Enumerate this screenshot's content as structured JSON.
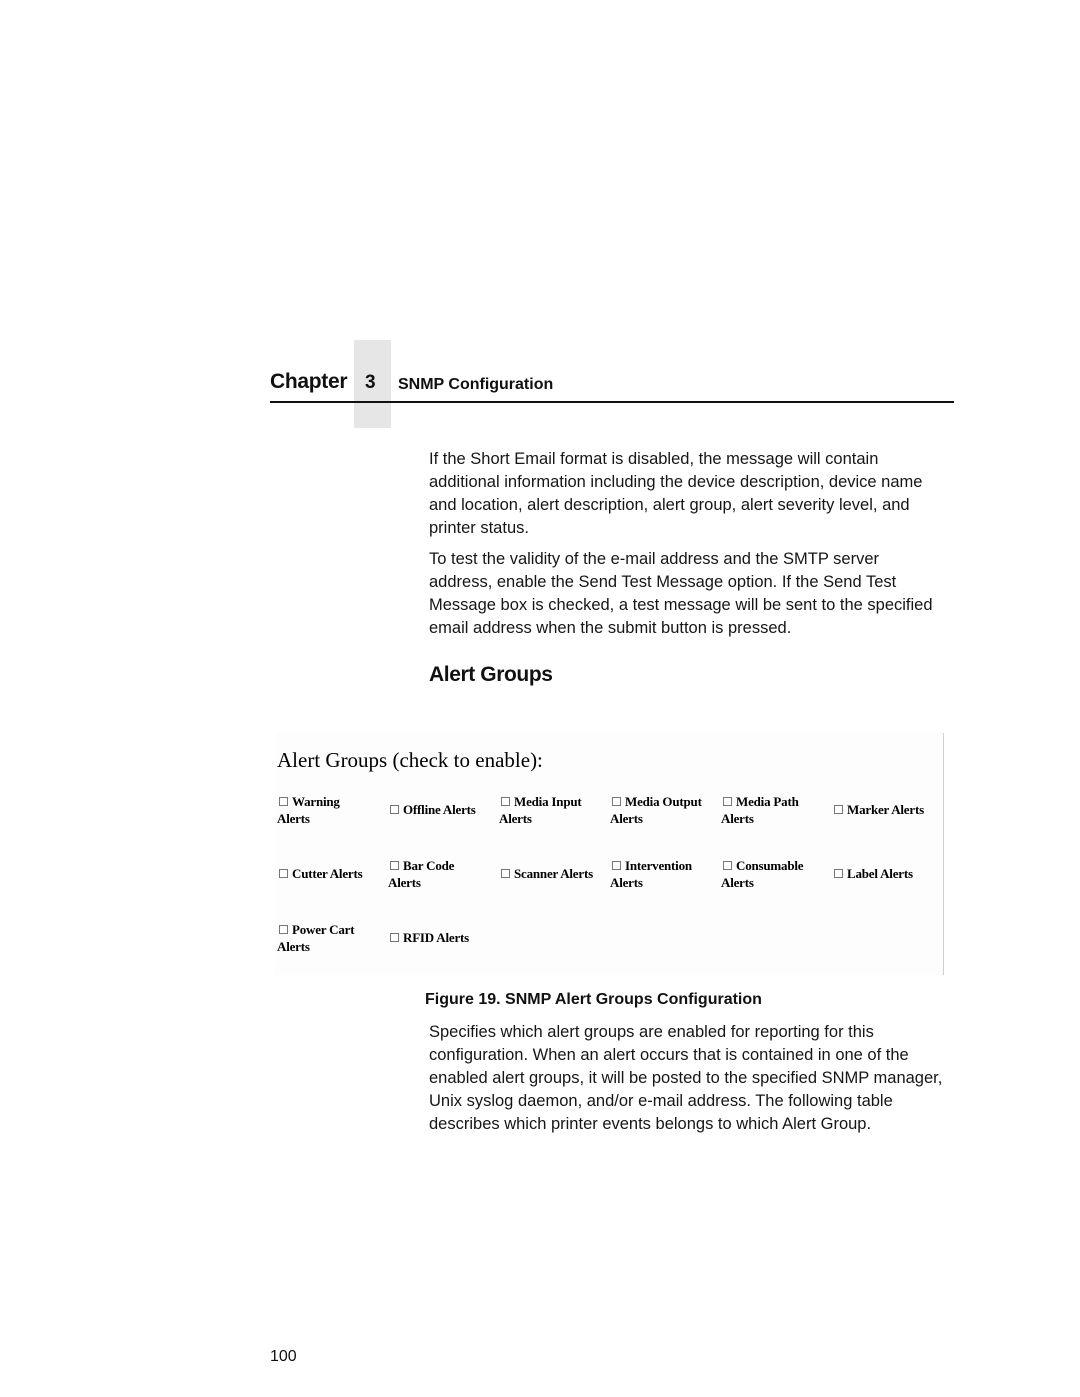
{
  "header": {
    "chapter_word": "Chapter",
    "chapter_number": "3",
    "chapter_title": "SNMP Configuration"
  },
  "body": {
    "paragraph_1": "If the Short Email format is disabled, the message will contain additional information including the device description, device name and location, alert description, alert group, alert severity level, and printer status.",
    "paragraph_2": "To test the validity of the e-mail address and the SMTP server address, enable the Send Test Message option. If the Send Test Message box is checked, a test message will be sent to the specified email address when the submit button is pressed.",
    "section_heading": "Alert Groups",
    "paragraph_3": "Specifies which alert groups are enabled for reporting for this configuration. When an alert occurs that is contained in one of the enabled alert groups, it will be posted to the specified SNMP manager, Unix syslog daemon, and/or e-mail address. The following table describes which printer events belongs to which Alert Group."
  },
  "figure": {
    "title": "Alert Groups (check to enable):",
    "caption": "Figure 19. SNMP Alert Groups Configuration",
    "rows": [
      [
        {
          "line1": "Warning",
          "line2": "Alerts",
          "checked": false
        },
        {
          "line1": "Offline Alerts",
          "line2": "",
          "checked": false
        },
        {
          "line1": "Media Input",
          "line2": "Alerts",
          "checked": false
        },
        {
          "line1": "Media Output",
          "line2": "Alerts",
          "checked": false
        },
        {
          "line1": "Media Path",
          "line2": "Alerts",
          "checked": false
        },
        {
          "line1": "Marker Alerts",
          "line2": "",
          "checked": false
        }
      ],
      [
        {
          "line1": "Cutter Alerts",
          "line2": "",
          "checked": false
        },
        {
          "line1": "Bar Code",
          "line2": "Alerts",
          "checked": false
        },
        {
          "line1": "Scanner Alerts",
          "line2": "",
          "checked": false
        },
        {
          "line1": "Intervention",
          "line2": "Alerts",
          "checked": false
        },
        {
          "line1": "Consumable",
          "line2": "Alerts",
          "checked": false
        },
        {
          "line1": "Label Alerts",
          "line2": "",
          "checked": false
        }
      ],
      [
        {
          "line1": "Power Cart",
          "line2": "Alerts",
          "checked": false
        },
        {
          "line1": "RFID Alerts",
          "line2": "",
          "checked": false
        }
      ]
    ]
  },
  "footer": {
    "page_number": "100"
  }
}
